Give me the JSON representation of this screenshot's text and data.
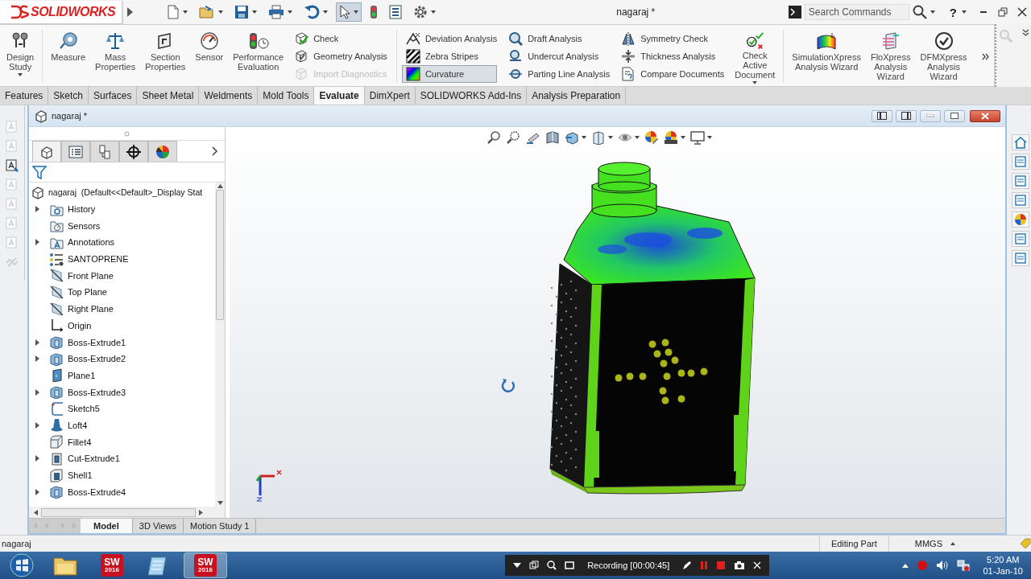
{
  "title_bar": {
    "logo": "SOLIDWORKS",
    "document_title": "nagaraj *",
    "search": {
      "placeholder": "Search Commands"
    },
    "help": "?"
  },
  "quick_access_tools": [
    {
      "selected": false,
      "dropdown": true
    },
    {
      "selected": false,
      "dropdown": true
    },
    {
      "selected": false,
      "dropdown": true
    },
    {
      "selected": false,
      "dropdown": true
    },
    {
      "selected": false,
      "dropdown": true
    },
    {
      "selected": true,
      "dropdown": true
    },
    {
      "selected": false,
      "dropdown": false
    },
    {
      "selected": false,
      "dropdown": false
    },
    {
      "selected": false,
      "dropdown": true
    }
  ],
  "ribbon": {
    "items": [
      {
        "kind": "big",
        "label": "Design Study",
        "dropdown": true
      },
      {
        "kind": "separator"
      },
      {
        "kind": "big",
        "label": "Measure",
        "dropdown": false
      },
      {
        "kind": "big",
        "label": "Mass Properties",
        "dropdown": false
      },
      {
        "kind": "big",
        "label": "Section Properties",
        "dropdown": false
      },
      {
        "kind": "big",
        "label": "Sensor",
        "dropdown": false
      },
      {
        "kind": "big",
        "label": "Performance Evaluation",
        "dropdown": false
      },
      {
        "kind": "stack",
        "buttons": [
          {
            "label": "Check",
            "selected": false,
            "disabled": false
          },
          {
            "label": "Geometry Analysis",
            "selected": false,
            "disabled": false
          },
          {
            "label": "Import Diagnostics",
            "selected": false,
            "disabled": true
          }
        ]
      },
      {
        "kind": "separator"
      },
      {
        "kind": "stack",
        "buttons": [
          {
            "label": "Deviation Analysis",
            "selected": false,
            "disabled": false
          },
          {
            "label": "Zebra Stripes",
            "selected": false,
            "disabled": false
          },
          {
            "label": "Curvature",
            "selected": true,
            "disabled": false
          }
        ]
      },
      {
        "kind": "stack",
        "buttons": [
          {
            "label": "Draft Analysis",
            "selected": false,
            "disabled": false
          },
          {
            "label": "Undercut Analysis",
            "selected": false,
            "disabled": false
          },
          {
            "label": "Parting Line Analysis",
            "selected": false,
            "disabled": false
          }
        ]
      },
      {
        "kind": "stack",
        "buttons": [
          {
            "label": "Symmetry Check",
            "selected": false,
            "disabled": false
          },
          {
            "label": "Thickness Analysis",
            "selected": false,
            "disabled": false
          },
          {
            "label": "Compare Documents",
            "selected": false,
            "disabled": false
          }
        ]
      },
      {
        "kind": "big",
        "label": "Check Active Document",
        "dropdown": true
      },
      {
        "kind": "separator"
      },
      {
        "kind": "big",
        "label": "SimulationXpress Analysis Wizard",
        "dropdown": false
      },
      {
        "kind": "big",
        "label": "FloXpress Analysis Wizard",
        "dropdown": false
      },
      {
        "kind": "big",
        "label": "DFMXpress Analysis Wizard",
        "dropdown": false
      }
    ]
  },
  "command_tabs": [
    {
      "label": "Features",
      "selected": false
    },
    {
      "label": "Sketch",
      "selected": false
    },
    {
      "label": "Surfaces",
      "selected": false
    },
    {
      "label": "Sheet Metal",
      "selected": false
    },
    {
      "label": "Weldments",
      "selected": false
    },
    {
      "label": "Mold Tools",
      "selected": false
    },
    {
      "label": "Evaluate",
      "selected": true
    },
    {
      "label": "DimXpert",
      "selected": false
    },
    {
      "label": "SOLIDWORKS Add-Ins",
      "selected": false
    },
    {
      "label": "Analysis Preparation",
      "selected": false
    }
  ],
  "left_toolbar": [
    {
      "disabled": true
    },
    {
      "disabled": true
    },
    {
      "disabled": false
    },
    {
      "disabled": true
    },
    {
      "disabled": true
    },
    {
      "disabled": true
    },
    {
      "disabled": true
    },
    {
      "disabled": true
    }
  ],
  "document": {
    "title": "nagaraj *",
    "panel_tabs": [
      {
        "selected": true
      },
      {
        "selected": false
      },
      {
        "selected": false
      },
      {
        "selected": false
      },
      {
        "selected": false
      }
    ],
    "tree": {
      "root": "nagaraj  (Default<<Default>_Display Stat",
      "items": [
        {
          "label": "History",
          "kind": "history",
          "expandable": true
        },
        {
          "label": "Sensors",
          "kind": "sensors",
          "expandable": false
        },
        {
          "label": "Annotations",
          "kind": "annotations",
          "expandable": true
        },
        {
          "label": "SANTOPRENE",
          "kind": "material",
          "expandable": false
        },
        {
          "label": "Front Plane",
          "kind": "plane",
          "expandable": false
        },
        {
          "label": "Top Plane",
          "kind": "plane",
          "expandable": false
        },
        {
          "label": "Right Plane",
          "kind": "plane",
          "expandable": false
        },
        {
          "label": "Origin",
          "kind": "origin",
          "expandable": false
        },
        {
          "label": "Boss-Extrude1",
          "kind": "extrude",
          "expandable": true
        },
        {
          "label": "Boss-Extrude2",
          "kind": "extrude",
          "expandable": true
        },
        {
          "label": "Plane1",
          "kind": "refplane",
          "expandable": false
        },
        {
          "label": "Boss-Extrude3",
          "kind": "extrude",
          "expandable": true
        },
        {
          "label": "Sketch5",
          "kind": "sketch",
          "expandable": false
        },
        {
          "label": "Loft4",
          "kind": "loft",
          "expandable": true
        },
        {
          "label": "Fillet4",
          "kind": "fillet",
          "expandable": false
        },
        {
          "label": "Cut-Extrude1",
          "kind": "cut",
          "expandable": true
        },
        {
          "label": "Shell1",
          "kind": "shell",
          "expandable": false
        },
        {
          "label": "Boss-Extrude4",
          "kind": "extrude",
          "expandable": true
        }
      ]
    },
    "bottom_tabs": [
      {
        "label": "Model",
        "selected": true
      },
      {
        "label": "3D Views",
        "selected": false
      },
      {
        "label": "Motion Study 1",
        "selected": false
      }
    ]
  },
  "status_bar": {
    "document": "nagaraj",
    "mode": "Editing Part",
    "units": "MMGS"
  },
  "taskbar": {
    "apps": [
      {
        "kind": "explorer",
        "active": false
      },
      {
        "kind": "solidworks",
        "label": "SW",
        "version": "2016",
        "active": false
      },
      {
        "kind": "notepad",
        "active": false
      },
      {
        "kind": "solidworks",
        "label": "SW",
        "version": "2016",
        "active": true
      }
    ],
    "recording": "Recording [00:00:45]",
    "time": "5:20 AM",
    "date": "01-Jan-10"
  }
}
